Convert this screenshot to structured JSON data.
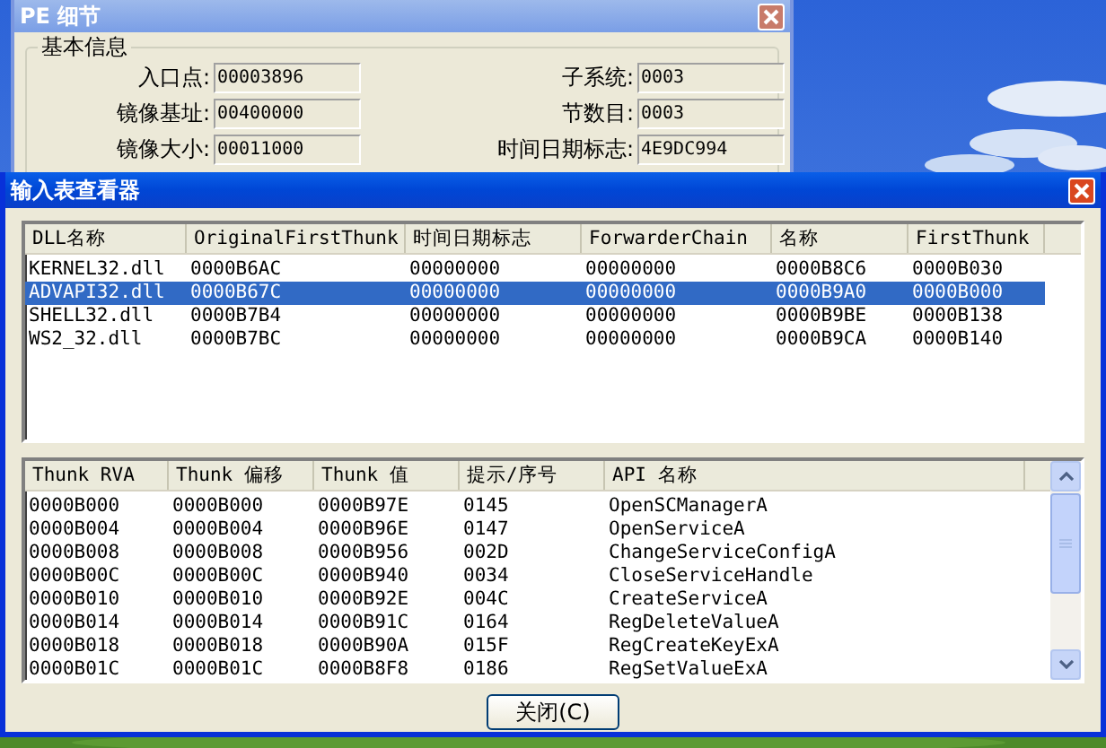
{
  "back_window": {
    "title": "PE 细节",
    "group": "基本信息",
    "fields": [
      {
        "label": "入口点:",
        "value": "00003896"
      },
      {
        "label": "子系统:",
        "value": "0003"
      },
      {
        "label": "镜像基址:",
        "value": "00400000"
      },
      {
        "label": "节数目:",
        "value": "0003"
      },
      {
        "label": "镜像大小:",
        "value": "00011000"
      },
      {
        "label": "时间日期标志:",
        "value": "4E9DC994"
      }
    ]
  },
  "dialog": {
    "title": "输入表查看器",
    "dll_table": {
      "columns": [
        "DLL名称",
        "OriginalFirstThunk",
        "时间日期标志",
        "ForwarderChain",
        "名称",
        "FirstThunk"
      ],
      "rows": [
        {
          "selected": false,
          "cells": [
            "KERNEL32.dll",
            "0000B6AC",
            "00000000",
            "00000000",
            "0000B8C6",
            "0000B030"
          ]
        },
        {
          "selected": true,
          "cells": [
            "ADVAPI32.dll",
            "0000B67C",
            "00000000",
            "00000000",
            "0000B9A0",
            "0000B000"
          ]
        },
        {
          "selected": false,
          "cells": [
            "SHELL32.dll",
            "0000B7B4",
            "00000000",
            "00000000",
            "0000B9BE",
            "0000B138"
          ]
        },
        {
          "selected": false,
          "cells": [
            "WS2_32.dll",
            "0000B7BC",
            "00000000",
            "00000000",
            "0000B9CA",
            "0000B140"
          ]
        }
      ]
    },
    "thunk_table": {
      "columns": [
        "Thunk RVA",
        "Thunk 偏移",
        "Thunk 值",
        "提示/序号",
        "API 名称"
      ],
      "rows": [
        [
          "0000B000",
          "0000B000",
          "0000B97E",
          "0145",
          "OpenSCManagerA"
        ],
        [
          "0000B004",
          "0000B004",
          "0000B96E",
          "0147",
          "OpenServiceA"
        ],
        [
          "0000B008",
          "0000B008",
          "0000B956",
          "002D",
          "ChangeServiceConfigA"
        ],
        [
          "0000B00C",
          "0000B00C",
          "0000B940",
          "0034",
          "CloseServiceHandle"
        ],
        [
          "0000B010",
          "0000B010",
          "0000B92E",
          "004C",
          "CreateServiceA"
        ],
        [
          "0000B014",
          "0000B014",
          "0000B91C",
          "0164",
          "RegDeleteValueA"
        ],
        [
          "0000B018",
          "0000B018",
          "0000B90A",
          "015F",
          "RegCreateKeyExA"
        ],
        [
          "0000B01C",
          "0000B01C",
          "0000B8F8",
          "0186",
          "RegSetValueExA"
        ]
      ]
    },
    "close_button": "关闭(C)"
  }
}
